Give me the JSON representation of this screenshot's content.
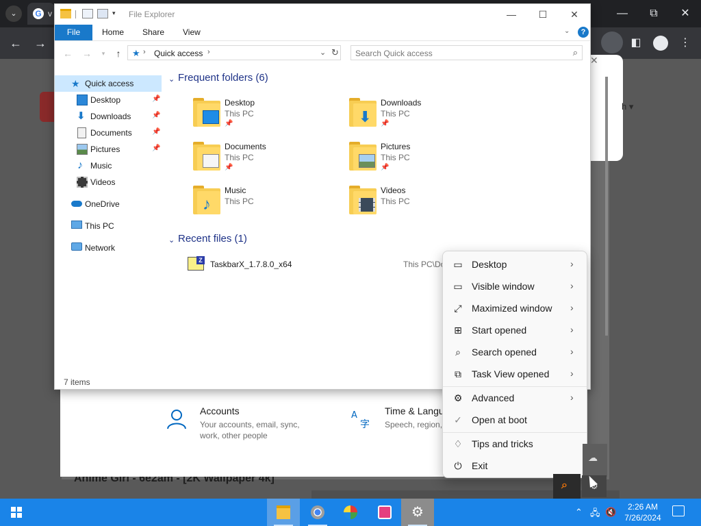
{
  "browser": {
    "tab_title": "v",
    "sort_hint": "h ▾",
    "bg_article_title": "Anime Girl - 6e2am - [2K Wallpaper 4k]",
    "g_logo": "G",
    "tab_menu_glyph": "⌄",
    "nav_back": "←",
    "nav_forward": "→",
    "win_minimize": "—",
    "win_restore": "⧉",
    "win_close": "✕"
  },
  "explorer": {
    "title": "File Explorer",
    "ribbon_tabs": [
      "File",
      "Home",
      "Share",
      "View"
    ],
    "help_glyph": "?",
    "address": {
      "location": "Quick access"
    },
    "search": {
      "placeholder": "Search Quick access"
    },
    "nav_pane": [
      {
        "label": "Quick access",
        "icon": "star-icon"
      },
      {
        "label": "Desktop",
        "icon": "desktop-icon",
        "pinned": true
      },
      {
        "label": "Downloads",
        "icon": "downloads-icon",
        "pinned": true
      },
      {
        "label": "Documents",
        "icon": "documents-icon",
        "pinned": true
      },
      {
        "label": "Pictures",
        "icon": "pictures-icon",
        "pinned": true
      },
      {
        "label": "Music",
        "icon": "music-icon"
      },
      {
        "label": "Videos",
        "icon": "videos-icon"
      },
      {
        "label": "OneDrive",
        "icon": "cloud-icon"
      },
      {
        "label": "This PC",
        "icon": "computer-icon"
      },
      {
        "label": "Network",
        "icon": "network-icon"
      }
    ],
    "frequent_header": "Frequent folders (6)",
    "frequent_folders": [
      {
        "name": "Desktop",
        "location": "This PC",
        "icon": "desktop-folder-icon"
      },
      {
        "name": "Downloads",
        "location": "This PC",
        "icon": "downloads-folder-icon"
      },
      {
        "name": "Documents",
        "location": "This PC",
        "icon": "documents-folder-icon"
      },
      {
        "name": "Pictures",
        "location": "This PC",
        "icon": "pictures-folder-icon"
      },
      {
        "name": "Music",
        "location": "This PC",
        "icon": "music-folder-icon"
      },
      {
        "name": "Videos",
        "location": "This PC",
        "icon": "videos-folder-icon"
      }
    ],
    "recent_header": "Recent files (1)",
    "recent_files": [
      {
        "name": "TaskbarX_1.7.8.0_x64",
        "path": "This PC\\Do",
        "icon": "zip-file-icon"
      }
    ],
    "status": "7 items"
  },
  "settings": {
    "items": [
      {
        "title": "Accounts",
        "desc1": "Your accounts, email, sync,",
        "desc2": "work, other people",
        "icon": "person-icon"
      },
      {
        "title": "Time & Langu",
        "desc1": "Speech, region,",
        "desc2": "",
        "icon": "language-icon"
      }
    ]
  },
  "context_menu": {
    "items": [
      {
        "label": "Desktop",
        "icon": "desktop-outline-icon",
        "icon_glyph": "▭",
        "submenu": true
      },
      {
        "label": "Visible window",
        "icon": "window-icon",
        "icon_glyph": "▭",
        "submenu": true
      },
      {
        "label": "Maximized window",
        "icon": "maximize-arrow-icon",
        "icon_glyph": "⤢",
        "submenu": true
      },
      {
        "label": "Start opened",
        "icon": "windows-logo-icon",
        "icon_glyph": "⊞",
        "submenu": true
      },
      {
        "label": "Search opened",
        "icon": "search-icon",
        "icon_glyph": "⌕",
        "submenu": true
      },
      {
        "label": "Task View opened",
        "icon": "task-view-icon",
        "icon_glyph": "⧉",
        "submenu": true
      },
      {
        "label": "Advanced",
        "icon": "gear-icon",
        "icon_glyph": "⚙",
        "submenu": true
      },
      {
        "label": "Open at boot",
        "icon": "checkmark-icon",
        "icon_glyph": "✓",
        "submenu": false
      },
      {
        "label": "Tips and tricks",
        "icon": "lightbulb-icon",
        "icon_glyph": "♢",
        "submenu": false
      },
      {
        "label": "Exit",
        "icon": "power-icon",
        "icon_glyph": "⏻",
        "submenu": false
      }
    ]
  },
  "taskbar": {
    "time": "2:26 AM",
    "date": "7/26/2024",
    "apps": [
      "file-explorer-icon",
      "chrome-icon",
      "photos-icon",
      "app-icon",
      "settings-gear-icon"
    ]
  },
  "colors": {
    "accent": "#1979ca",
    "taskbar": "#1a84e8",
    "selection": "#cce8ff",
    "group_header": "#1e3287"
  }
}
